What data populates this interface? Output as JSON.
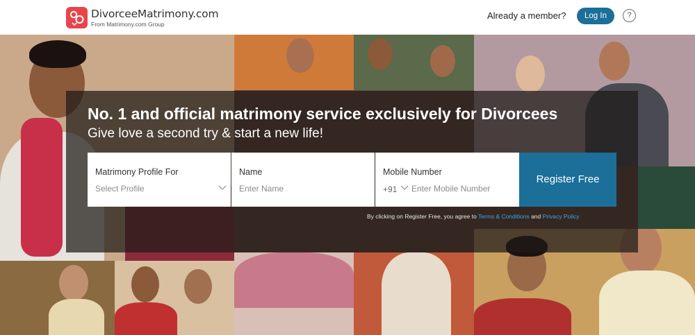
{
  "header": {
    "logo_title": "DivorceeMatrimony.com",
    "logo_subtitle": "From Matrimony.com Group",
    "member_prompt": "Already a member?",
    "login_label": "Log In",
    "help_label": "?"
  },
  "hero": {
    "headline": "No. 1 and official matrimony service exclusively for Divorcees",
    "subline": "Give love a second try & start a new life!"
  },
  "form": {
    "profile_for": {
      "label": "Matrimony Profile For",
      "placeholder": "Select Profile"
    },
    "name": {
      "label": "Name",
      "placeholder": "Enter Name"
    },
    "mobile": {
      "label": "Mobile Number",
      "country_code": "+91",
      "placeholder": "Enter Mobile Number"
    },
    "register_label": "Register Free"
  },
  "terms": {
    "prefix": "By clicking on Register Free, you agree to ",
    "terms_link": "Terms & Conditions",
    "conjunction": " and ",
    "privacy_link": "Privacy Policy"
  },
  "icons": {
    "logo": "hearts-logo-icon",
    "help": "question-icon",
    "dropdown": "chevron-down-icon"
  },
  "colors": {
    "brand_red": "#e8444c",
    "primary_blue": "#1b6f99",
    "link_blue": "#3ea6e6"
  }
}
